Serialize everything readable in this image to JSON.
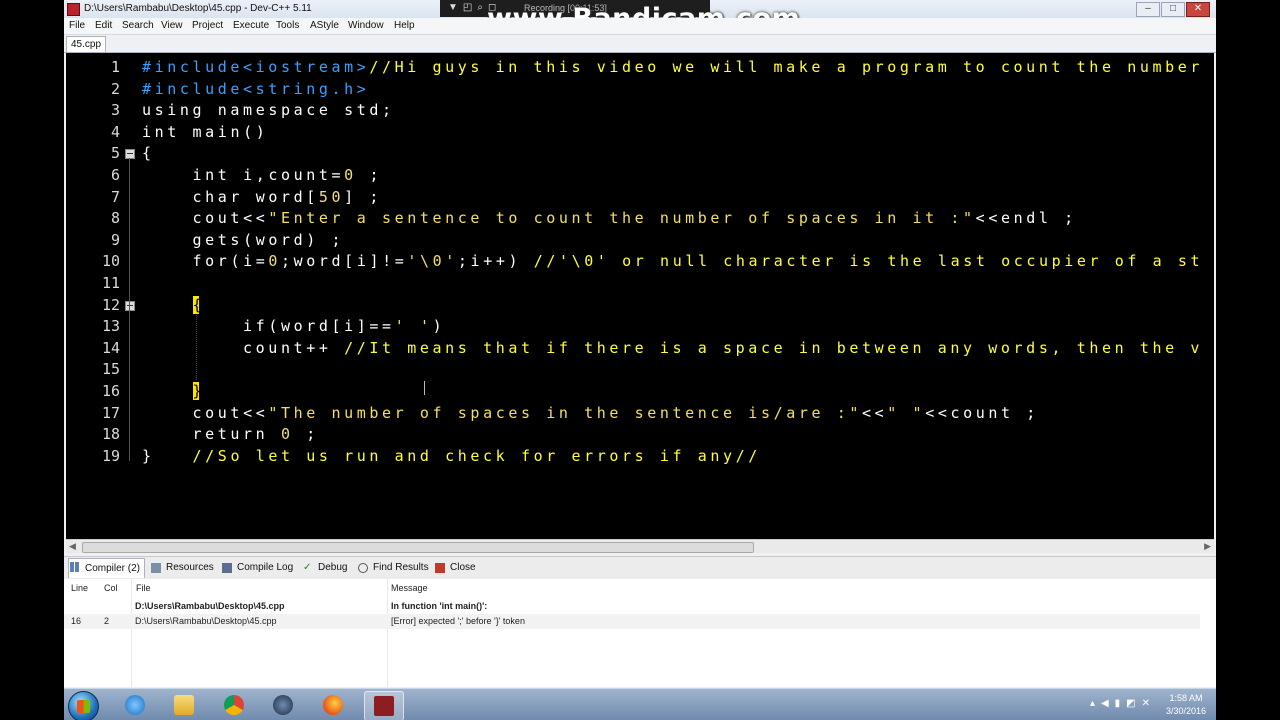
{
  "window": {
    "title": "D:\\Users\\Rambabu\\Desktop\\45.cpp - Dev-C++ 5.11"
  },
  "recorder": {
    "text": "Recording [00:11:53]",
    "watermark": "www.Bandicam.com"
  },
  "menu": {
    "items": [
      "File",
      "Edit",
      "Search",
      "View",
      "Project",
      "Execute",
      "Tools",
      "AStyle",
      "Window",
      "Help"
    ]
  },
  "editor": {
    "tab_label": "45.cpp",
    "line_numbers": [
      "1",
      "2",
      "3",
      "4",
      "5",
      "6",
      "7",
      "8",
      "9",
      "10",
      "11",
      "12",
      "13",
      "14",
      "15",
      "16",
      "17",
      "18",
      "19"
    ],
    "lines": [
      "#include<iostream>//Hi guys in this video we will make a program to count the number",
      "#include<string.h>",
      "using namespace std;",
      "int main()",
      "{",
      "    int i,count=0 ;",
      "    char word[50] ;",
      "    cout<<\"Enter a sentence to count the number of spaces in it :\"<<endl ;",
      "    gets(word) ;",
      "    for(i=0;word[i]!='\\0';i++) //'\\0' or null character is the last occupier of a st",
      "",
      "    {",
      "        if(word[i]==' ')",
      "        count++ //It means that if there is a space in between any words, then the v",
      "",
      "    }",
      "    cout<<\"The number of spaces in the sentence is/are :\"<<\" \"<<count ;",
      "    return 0 ;",
      "}   //So let us run and check for errors if any//"
    ]
  },
  "bottom_tabs": [
    {
      "label": "Compiler (2)"
    },
    {
      "label": "Resources"
    },
    {
      "label": "Compile Log"
    },
    {
      "label": "Debug"
    },
    {
      "label": "Find Results"
    },
    {
      "label": "Close"
    }
  ],
  "compiler": {
    "headers": {
      "line": "Line",
      "col": "Col",
      "file": "File",
      "message": "Message"
    },
    "rows": [
      {
        "line": "",
        "col": "",
        "file": "D:\\Users\\Rambabu\\Desktop\\45.cpp",
        "message": "In function 'int main()':"
      },
      {
        "line": "16",
        "col": "2",
        "file": "D:\\Users\\Rambabu\\Desktop\\45.cpp",
        "message": "[Error] expected ';' before '}' token"
      }
    ]
  },
  "taskbar": {
    "time": "1:58 AM",
    "date": "3/30/2016",
    "icons": [
      "start-orb",
      "internet-explorer",
      "file-explorer",
      "chrome",
      "media-player",
      "firefox",
      "dev-cpp"
    ]
  },
  "colors": {
    "editor_bg": "#000000",
    "preprocessor": "#3aa0ff",
    "keyword": "#ffffff",
    "string": "#f2e15a",
    "comment": "#ffff33",
    "brace_highlight": "#ffe400"
  }
}
